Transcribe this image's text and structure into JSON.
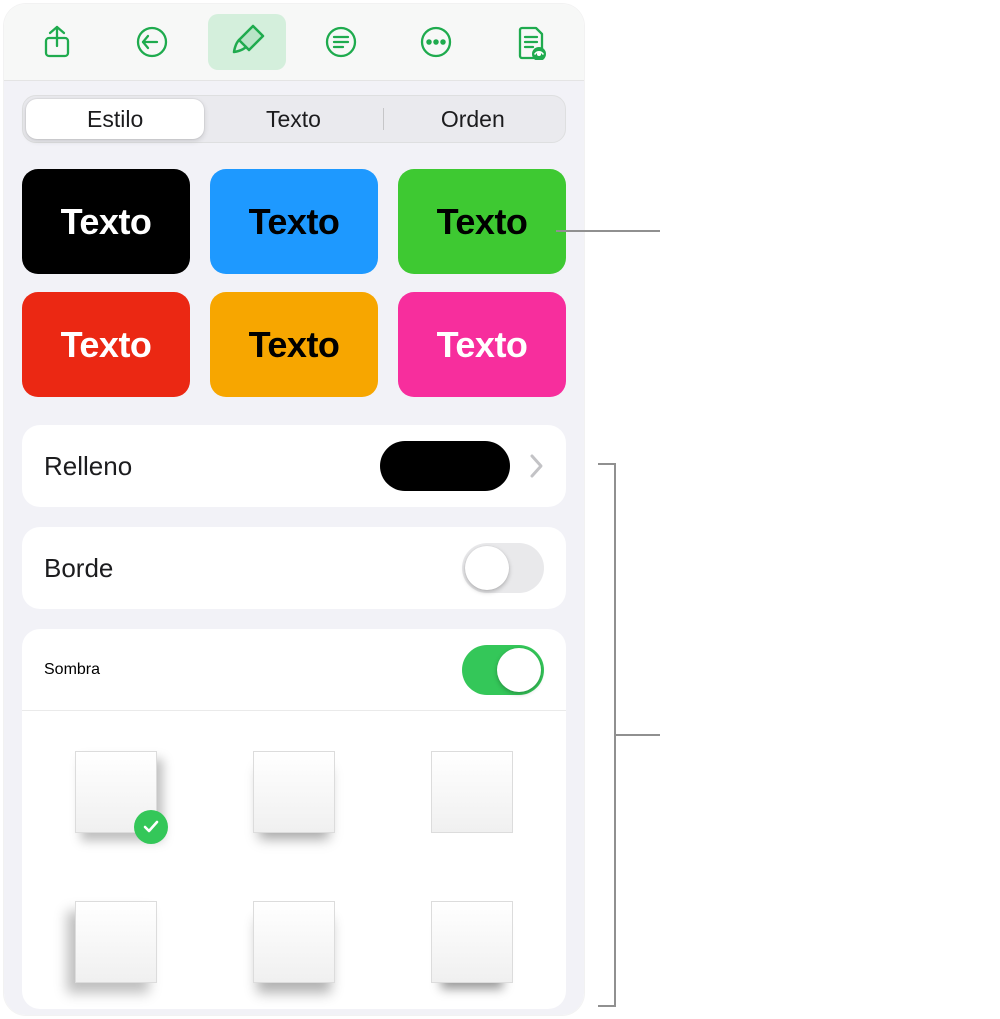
{
  "toolbar": {
    "icons": [
      "share-icon",
      "undo-icon",
      "brush-icon",
      "list-icon",
      "more-icon",
      "doc-view-icon"
    ],
    "active_index": 2
  },
  "tabs": {
    "items": [
      "Estilo",
      "Texto",
      "Orden"
    ],
    "active_index": 0
  },
  "presets": [
    {
      "bg": "#000000",
      "fg": "#ffffff",
      "label": "Texto"
    },
    {
      "bg": "#1e99ff",
      "fg": "#000000",
      "label": "Texto"
    },
    {
      "bg": "#3ec932",
      "fg": "#000000",
      "label": "Texto"
    },
    {
      "bg": "#eb2813",
      "fg": "#ffffff",
      "label": "Texto"
    },
    {
      "bg": "#f7a600",
      "fg": "#000000",
      "label": "Texto"
    },
    {
      "bg": "#f72e9d",
      "fg": "#ffffff",
      "label": "Texto"
    }
  ],
  "fill": {
    "label": "Relleno",
    "swatch": "#000000"
  },
  "border": {
    "label": "Borde",
    "enabled": false
  },
  "shadow": {
    "label": "Sombra",
    "enabled": true,
    "selected_index": 0
  }
}
